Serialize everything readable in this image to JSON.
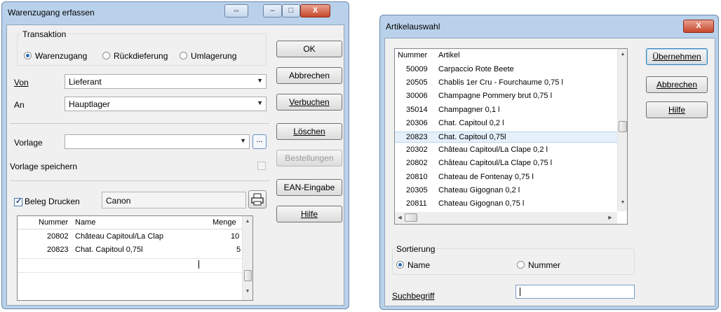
{
  "warenzugang": {
    "title": "Warenzugang erfassen",
    "title_buttons": [
      "⇔",
      "–",
      "□",
      "X"
    ],
    "transaktion": {
      "label": "Transaktion",
      "options": [
        "Warenzugang",
        "Rückdieferung",
        "Umlagerung"
      ],
      "selected": "Warenzugang"
    },
    "von": {
      "label": "Von",
      "value": "Lieferant"
    },
    "an": {
      "label": "An",
      "value": "Hauptlager"
    },
    "vorlage": {
      "label": "Vorlage",
      "value": "",
      "browse": "..."
    },
    "vorlage_speichern": {
      "label": "Vorlage speichern",
      "checked": false
    },
    "beleg_drucken": {
      "label": "Beleg Drucken",
      "checked": true,
      "printer": "Canon"
    },
    "buttons": {
      "ok": "OK",
      "abbrechen": "Abbrechen",
      "verbuchen": "Verbuchen",
      "loeschen": "Löschen",
      "bestellungen": "Bestellungen",
      "ean": "EAN-Eingabe",
      "hilfe": "Hilfe"
    },
    "grid": {
      "columns": [
        "Nummer",
        "Name",
        "Menge"
      ],
      "rows": [
        [
          "20802",
          "Château Capitoul/La Clap",
          "10"
        ],
        [
          "20823",
          "Chat. Capitoul 0,75l",
          "5"
        ]
      ]
    }
  },
  "artikelauswahl": {
    "title": "Artikelauswahl",
    "close_label": "X",
    "list": {
      "columns": [
        "Nummer",
        "Artikel"
      ],
      "rows": [
        [
          "50009",
          "Carpaccio Rote Beete"
        ],
        [
          "20505",
          "Chablis 1er Cru - Fourchaume 0,75 l"
        ],
        [
          "30006",
          "Champagne Pommery brut 0,75 l"
        ],
        [
          "35014",
          "Champagner 0,1 l"
        ],
        [
          "20306",
          "Chat. Capitoul 0,2 l"
        ],
        [
          "20823",
          "Chat. Capitoul 0,75l"
        ],
        [
          "20302",
          "Château Capitoul/La Clape 0,2 l"
        ],
        [
          "20802",
          "Château Capitoul/La Clape 0,75 l"
        ],
        [
          "20810",
          "Chateau de Fontenay 0,75 l"
        ],
        [
          "20305",
          "Chateau Gigognan 0,2 l"
        ],
        [
          "20811",
          "Chateau Gigognan 0,75 l"
        ]
      ],
      "selected_row": 5
    },
    "buttons": {
      "uebernehmen": "Übernehmen",
      "abbrechen": "Abbrechen",
      "hilfe": "Hilfe"
    },
    "sortierung": {
      "label": "Sortierung",
      "options": [
        "Name",
        "Nummer"
      ],
      "selected": "Name"
    },
    "suchbegriff": {
      "label": "Suchbegriff",
      "value": ""
    }
  }
}
